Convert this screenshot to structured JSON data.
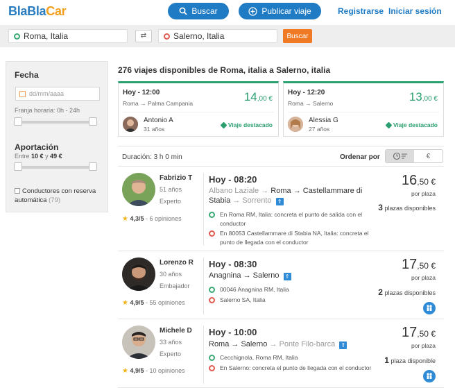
{
  "header": {
    "logo": {
      "part1": "Bla",
      "part2": "Bla",
      "part3": "Car"
    },
    "search_button": "Buscar",
    "publish_button": "Publicar viaje",
    "register_link": "Registrarse",
    "login_link": "Iniciar sesión"
  },
  "search": {
    "from": "Roma, Italia",
    "to": "Salerno, Italia",
    "submit": "Buscar"
  },
  "filters": {
    "date_title": "Fecha",
    "date_placeholder": "dd/mm/aaaa",
    "time_range_label": "Franja horaria: 0h - 24h",
    "contribution_title": "Aportación",
    "contribution_prefix": "Entre",
    "contribution_min": "10 €",
    "contribution_mid": "y",
    "contribution_max": "49 €",
    "auto_booking_label": "Conductores con reserva automática",
    "auto_booking_count": "(79)"
  },
  "results": {
    "title": "276 viajes disponibles de Roma, italia a Salerno, italia",
    "featured": [
      {
        "time": "Hoy - 12:00",
        "from": "Roma",
        "arrow": "→",
        "to": "Palma Campania",
        "price_int": "14",
        "price_dec": ",00 €",
        "driver": "Antonio A",
        "age": "31 años",
        "badge": "Viaje destacado"
      },
      {
        "time": "Hoy - 12:20",
        "from": "Roma",
        "arrow": "→",
        "to": "Salerno",
        "price_int": "13",
        "price_dec": ",00 €",
        "driver": "Alessia G",
        "age": "27 años",
        "badge": "Viaje destacado"
      }
    ],
    "duration": "Duración: 3 h 0 min",
    "sort_label": "Ordenar por",
    "sort_options": [
      "time",
      "price"
    ],
    "sort_price_symbol": "€",
    "trips": [
      {
        "driver": "Fabrizio T",
        "age": "51 años",
        "level": "Experto",
        "rating": "4,3/5",
        "reviews": "- 6 opiniones",
        "time": "Hoy - 08:20",
        "route_pre": "Albano Laziale →",
        "route_from": "Roma",
        "route_mid": "→",
        "route_to": "Castellammare di Stabia",
        "route_post": "→ Sorrento",
        "stop_from": "En Roma RM, Italia: concreta el punto de salida con el conductor",
        "stop_to": "En 80053 Castellammare di Stabia NA, Italia: concreta el punto de llegada con el conductor",
        "price_int": "16",
        "price_dec": ",50 €",
        "per_place": "por plaza",
        "seats_count": "3",
        "seats_label": "plazas disponibles"
      },
      {
        "driver": "Lorenzo R",
        "age": "30 años",
        "level": "Embajador",
        "rating": "4,9/5",
        "reviews": "- 55 opiniones",
        "time": "Hoy - 08:30",
        "route_from": "Anagnina",
        "route_mid": "→",
        "route_to": "Salerno",
        "stop_from": "00046 Anagnina RM, Italia",
        "stop_to": "Salerno SA, Italia",
        "price_int": "17",
        "price_dec": ",50 €",
        "per_place": "por plaza",
        "seats_count": "2",
        "seats_label": "plazas disponibles"
      },
      {
        "driver": "Michele D",
        "age": "33 años",
        "level": "Experto",
        "rating": "4,9/5",
        "reviews": "- 10 opiniones",
        "time": "Hoy - 10:00",
        "route_from": "Roma",
        "route_mid": "→",
        "route_to": "Salerno",
        "route_post": "→ Ponte Filo-barca",
        "stop_from": "Cecchignola, Roma RM, Italia",
        "stop_to": "En Salerno: concreta el punto de llegada con el conductor",
        "price_int": "17",
        "price_dec": ",50 €",
        "per_place": "por plaza",
        "seats_count": "1",
        "seats_label": "plaza disponible"
      }
    ]
  },
  "colors": {
    "brand_blue": "#1f7bc4",
    "brand_orange": "#f29e1c",
    "search_orange": "#f07a24",
    "featured_green": "#29a070"
  },
  "icons": [
    "search-icon",
    "plus-circle-icon",
    "swap-icon",
    "calendar-icon",
    "clock-sort-icon",
    "star-icon",
    "highway-icon",
    "passengers-icon",
    "tag-icon"
  ]
}
